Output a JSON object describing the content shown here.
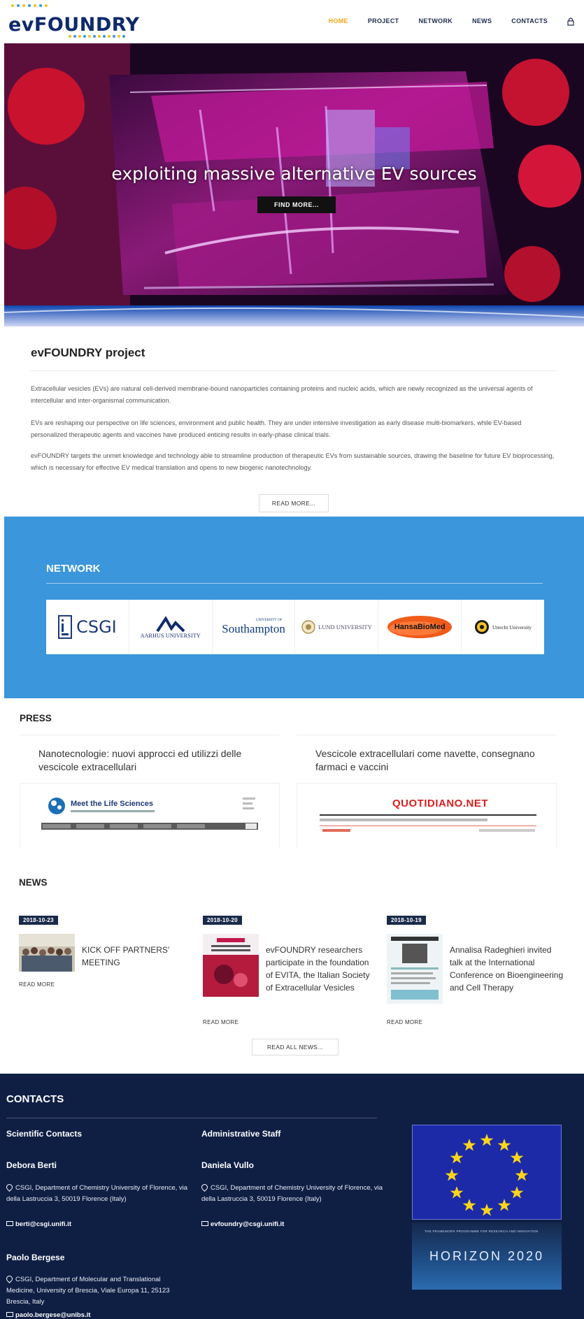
{
  "header": {
    "logo_text": "evFOUNDRY",
    "nav": [
      "HOME",
      "PROJECT",
      "NETWORK",
      "NEWS",
      "CONTACTS"
    ],
    "active_nav": "HOME",
    "accent_color": "#f2a51c"
  },
  "hero": {
    "title": "exploiting massive alternative EV sources",
    "button": "FIND MORE..."
  },
  "project": {
    "heading": "evFOUNDRY project",
    "paragraphs": [
      "Extracellular vesicles (EVs) are natural cell-derived membrane-bound nanoparticles containing proteins and nucleic acids, which are newly recognized as the universal agents of intercellular and inter-organismal communication.",
      "EVs are reshaping our perspective on life sciences, environment and public health. They are under intensive investigation as early disease multi-biomarkers, while EV-based personalized therapeutic agents and vaccines have produced enticing results in early-phase clinical trials.",
      "evFOUNDRY targets the unmet knowledge and technology able to streamline production of therapeutic EVs from sustainable sources, drawing the baseline for future EV bioprocessing, which is necessary for effective EV medical translation and opens to new biogenic nanotechnology."
    ],
    "button": "READ MORE..."
  },
  "network": {
    "heading": "NETWORK",
    "bg_color": "#3b96dc",
    "partners": [
      "CSGI",
      "AARHUS UNIVERSITY",
      "Southampton",
      "LUND UNIVERSITY",
      "HansaBioMed",
      "Utrecht University"
    ],
    "southampton_small": "UNIVERSITY OF"
  },
  "press": {
    "heading": "PRESS",
    "items": [
      {
        "title": "Nanotecnologie: nuovi approcci ed utilizzi delle vescicole extracellulari",
        "site": "Meet the Life Sciences"
      },
      {
        "title": "Vescicole extracellulari come navette, consegnano farmaci e vaccini",
        "site": "QUOTIDIANO.NET"
      }
    ]
  },
  "news": {
    "heading": "NEWS",
    "items": [
      {
        "date": "2018-10-23",
        "title": "KICK OFF PARTNERS' MEETING",
        "read_more": "READ MORE"
      },
      {
        "date": "2018-10-20",
        "title": "evFOUNDRY researchers participate in the foundation of EVITA, the Italian Society of Extracellular Vesicles",
        "read_more": "READ MORE"
      },
      {
        "date": "2018-10-19",
        "title": "Annalisa Radeghieri invited talk at the International Conference on Bioengineering and Cell Therapy",
        "read_more": "READ MORE"
      }
    ],
    "read_all": "READ ALL NEWS..."
  },
  "contacts": {
    "heading": "CONTACTS",
    "scientific_heading": "Scientific Contacts",
    "admin_heading": "Administrative Staff",
    "people": [
      {
        "name": "Debora Berti",
        "address": "CSGI, Department of Chemistry University of Florence, via della Lastruccia 3, 50019 Florence (Italy)",
        "email": "berti@csgi.unifi.it"
      },
      {
        "name": "Daniela Vullo",
        "address": "CSGI, Department of Chemistry University of Florence, via della Lastruccia 3, 50019 Florence (Italy)",
        "email": "evfoundry@csgi.unifi.it"
      },
      {
        "name": "Paolo Bergese",
        "address": "CSGI, Department of Molecular and Translational Medicine, University of Brescia, Viale Europa 11, 25123 Brescia, Italy",
        "email": "paolo.bergese@unibs.it"
      }
    ],
    "h2020_small": "THE FRAMEWORK PROGRAMME FOR RESEARCH AND INNOVATION",
    "h2020_big": "HORIZON 2020",
    "bg_color": "#0f1f44"
  }
}
